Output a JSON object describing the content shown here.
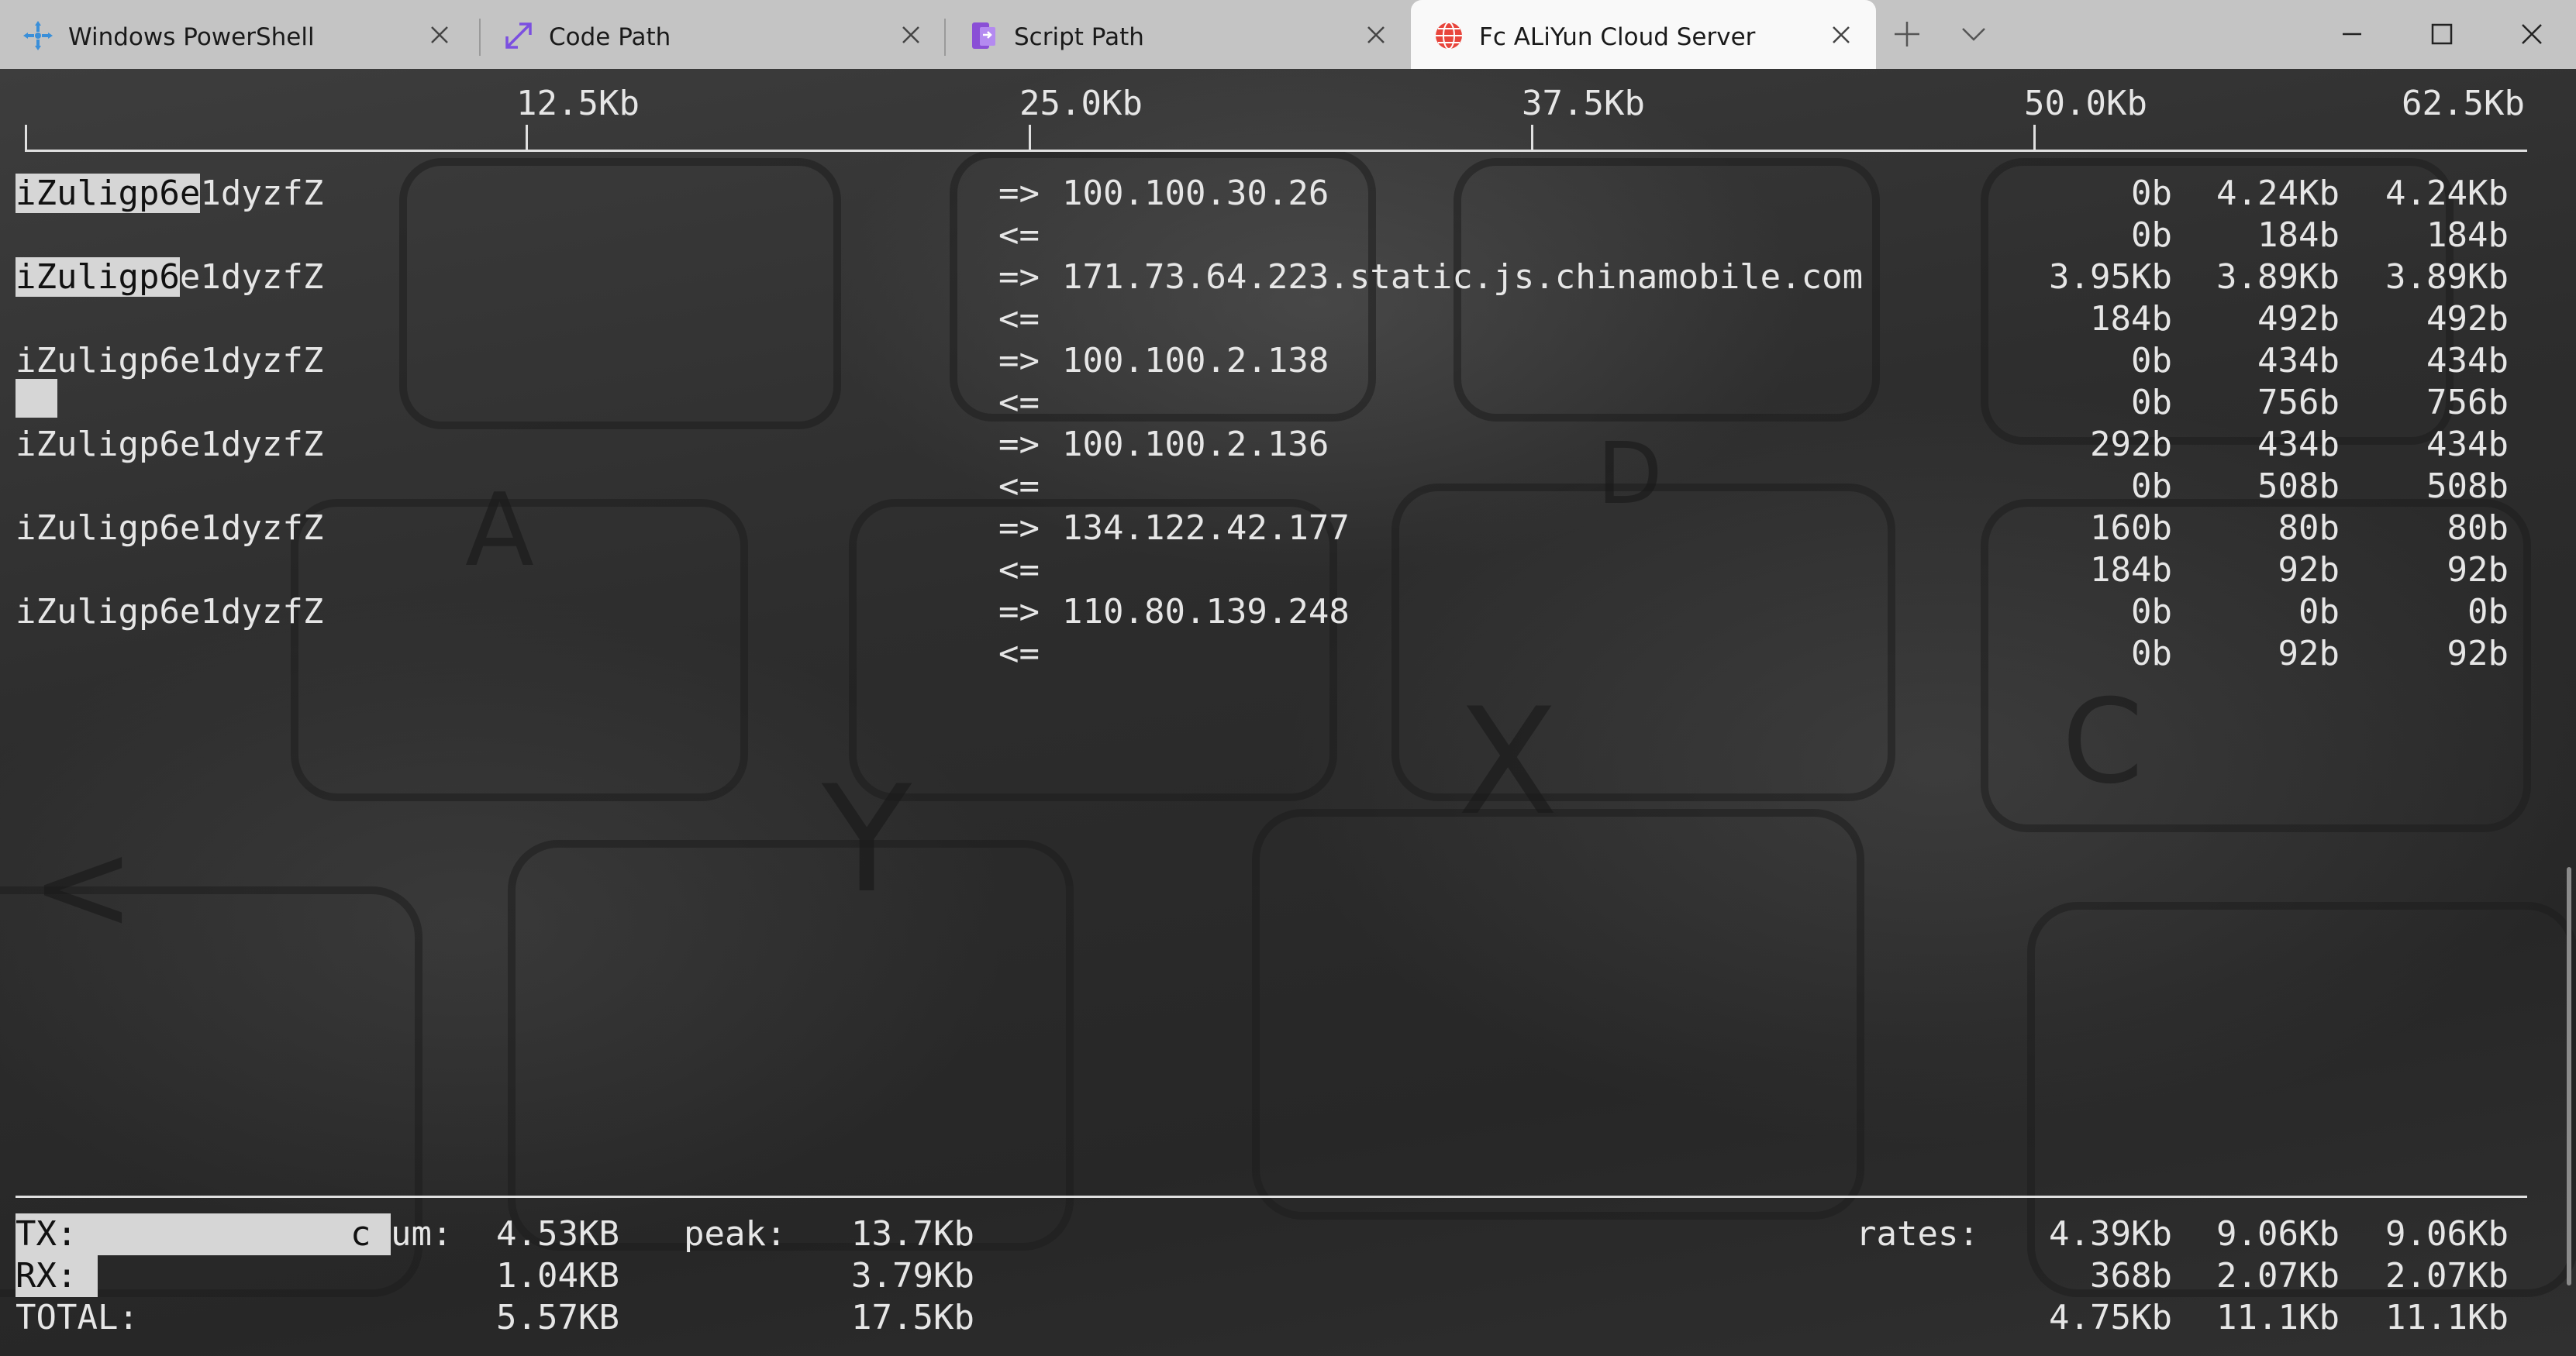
{
  "tabs": [
    {
      "title": "Windows PowerShell",
      "icon": "powershell-icon"
    },
    {
      "title": "Code Path",
      "icon": "expand-arrows-icon"
    },
    {
      "title": "Script Path",
      "icon": "script-icon"
    },
    {
      "title": "Fc ALiYun Cloud Server",
      "icon": "globe-icon",
      "active": true
    }
  ],
  "scale": {
    "labels": [
      "12.5Kb",
      "25.0Kb",
      "37.5Kb",
      "50.0Kb",
      "62.5Kb"
    ]
  },
  "connections": [
    {
      "host": "iZuligp6e1dyzfZ",
      "host_highlight_chars": 9,
      "peer": "100.100.30.26",
      "out": [
        "0b",
        "4.24Kb",
        "4.24Kb"
      ],
      "in": [
        "0b",
        "184b",
        "184b"
      ]
    },
    {
      "host": "iZuligp6e1dyzfZ",
      "host_highlight_chars": 8,
      "peer": "171.73.64.223.static.js.chinamobile.com",
      "out": [
        "3.95Kb",
        "3.89Kb",
        "3.89Kb"
      ],
      "in": [
        "184b",
        "492b",
        "492b"
      ]
    },
    {
      "host": "iZuligp6e1dyzfZ",
      "host_highlight_chars": 0,
      "peer": "100.100.2.138",
      "out": [
        "0b",
        "434b",
        "434b"
      ],
      "in": [
        "0b",
        "756b",
        "756b"
      ]
    },
    {
      "host": "iZuligp6e1dyzfZ",
      "host_highlight_chars": 0,
      "peer": "100.100.2.136",
      "out": [
        "292b",
        "434b",
        "434b"
      ],
      "in": [
        "0b",
        "508b",
        "508b"
      ]
    },
    {
      "host": "iZuligp6e1dyzfZ",
      "host_highlight_chars": 0,
      "peer": "134.122.42.177",
      "out": [
        "160b",
        "80b",
        "80b"
      ],
      "in": [
        "184b",
        "92b",
        "92b"
      ]
    },
    {
      "host": "iZuligp6e1dyzfZ",
      "host_highlight_chars": 0,
      "peer": "110.80.139.248",
      "out": [
        "0b",
        "0b",
        "0b"
      ],
      "in": [
        "0b",
        "92b",
        "92b"
      ]
    }
  ],
  "arrows": {
    "out": "=>",
    "in": "<="
  },
  "totals": {
    "tx_label": "TX:",
    "rx_label": "RX:",
    "total_label": "TOTAL:",
    "cum_label": "cum:",
    "peak_label": "peak:",
    "rates_label": "rates:",
    "tx": {
      "cum": "4.53KB",
      "peak": "13.7Kb",
      "rates": [
        "4.39Kb",
        "9.06Kb",
        "9.06Kb"
      ]
    },
    "rx": {
      "cum": "1.04KB",
      "peak": "3.79Kb",
      "rates": [
        "368b",
        "2.07Kb",
        "2.07Kb"
      ]
    },
    "total": {
      "cum": "5.57KB",
      "peak": "17.5Kb",
      "rates": [
        "4.75Kb",
        "11.1Kb",
        "11.1Kb"
      ]
    }
  }
}
